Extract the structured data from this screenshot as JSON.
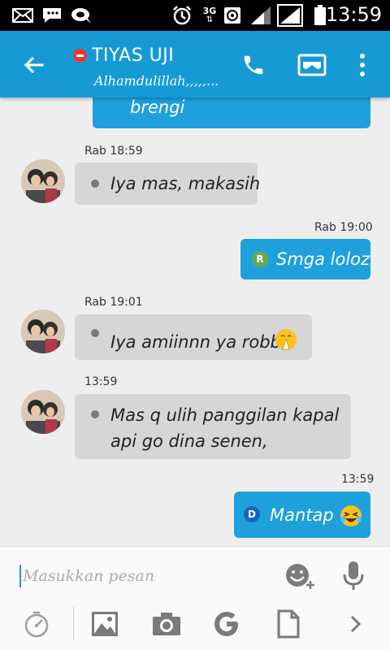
{
  "status_bar": {
    "time": "13:59",
    "network": "3G",
    "icons": [
      "mail-icon",
      "bbm-icon",
      "chat-bubble-icon",
      "alarm-icon",
      "network-3g-icon",
      "data-icon",
      "signal-icon",
      "signal-icon",
      "battery-icon"
    ]
  },
  "header": {
    "contact_name": "TIYAS UJI",
    "status_message": "Alhamdulillah,,,,,...",
    "presence": "busy",
    "icons": [
      "back-arrow-icon",
      "phone-icon",
      "mask-icon",
      "overflow-menu-icon"
    ]
  },
  "messages": [
    {
      "direction": "outgoing",
      "text": "brengi",
      "time": ""
    },
    {
      "direction": "incoming",
      "text": "Iya mas, makasih",
      "time": "Rab 18:59"
    },
    {
      "direction": "outgoing",
      "text": "Smga loloz",
      "time": "Rab 19:00",
      "status": "R"
    },
    {
      "direction": "incoming",
      "text": "Iya amiinnn ya robb",
      "time": "Rab 19:01",
      "emoji": "praying-face"
    },
    {
      "direction": "incoming",
      "text": "Mas q ulih panggilan kapal",
      "text2": "api go dina senen,",
      "time": "13:59"
    },
    {
      "direction": "outgoing",
      "text": "Mantap",
      "time": "13:59",
      "status": "D",
      "emoji": "laughing-face"
    }
  ],
  "composer": {
    "placeholder": "Masukkan pesan",
    "icons": [
      "emoji-add-icon",
      "microphone-icon",
      "timer-icon",
      "image-icon",
      "camera-icon",
      "google-icon",
      "document-icon",
      "chevron-right-icon"
    ]
  },
  "colors": {
    "app_bar": "#159ad6",
    "outgoing_bubble": "#1da0dc",
    "incoming_bubble": "#d6d6d6",
    "status_R": "#6aa84f",
    "status_D": "#1565c0"
  }
}
